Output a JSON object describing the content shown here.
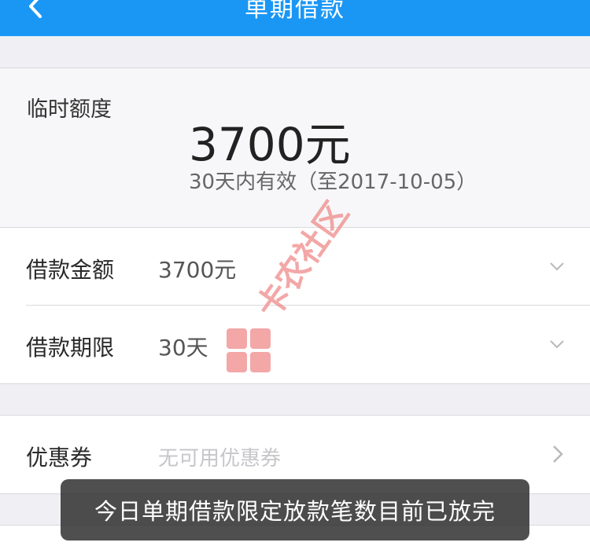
{
  "navbar": {
    "title": "单期借款",
    "back_icon": "chevron-left-icon",
    "background": "#1a97f5"
  },
  "quota": {
    "label": "临时额度",
    "amount": "3700元",
    "note": "30天内有效（至2017-10-05）"
  },
  "loan": {
    "amount_label": "借款金额",
    "amount_value": "3700元",
    "term_label": "借款期限",
    "term_value": "30天",
    "dropdown_icon": "chevron-down-icon"
  },
  "coupon": {
    "label": "优惠券",
    "placeholder": "无可用优惠券",
    "arrow_icon": "chevron-right-icon"
  },
  "watermark": {
    "text": "卡农社区",
    "color": "#f08a8a"
  },
  "toast": {
    "message": "今日单期借款限定放款笔数目前已放完"
  }
}
